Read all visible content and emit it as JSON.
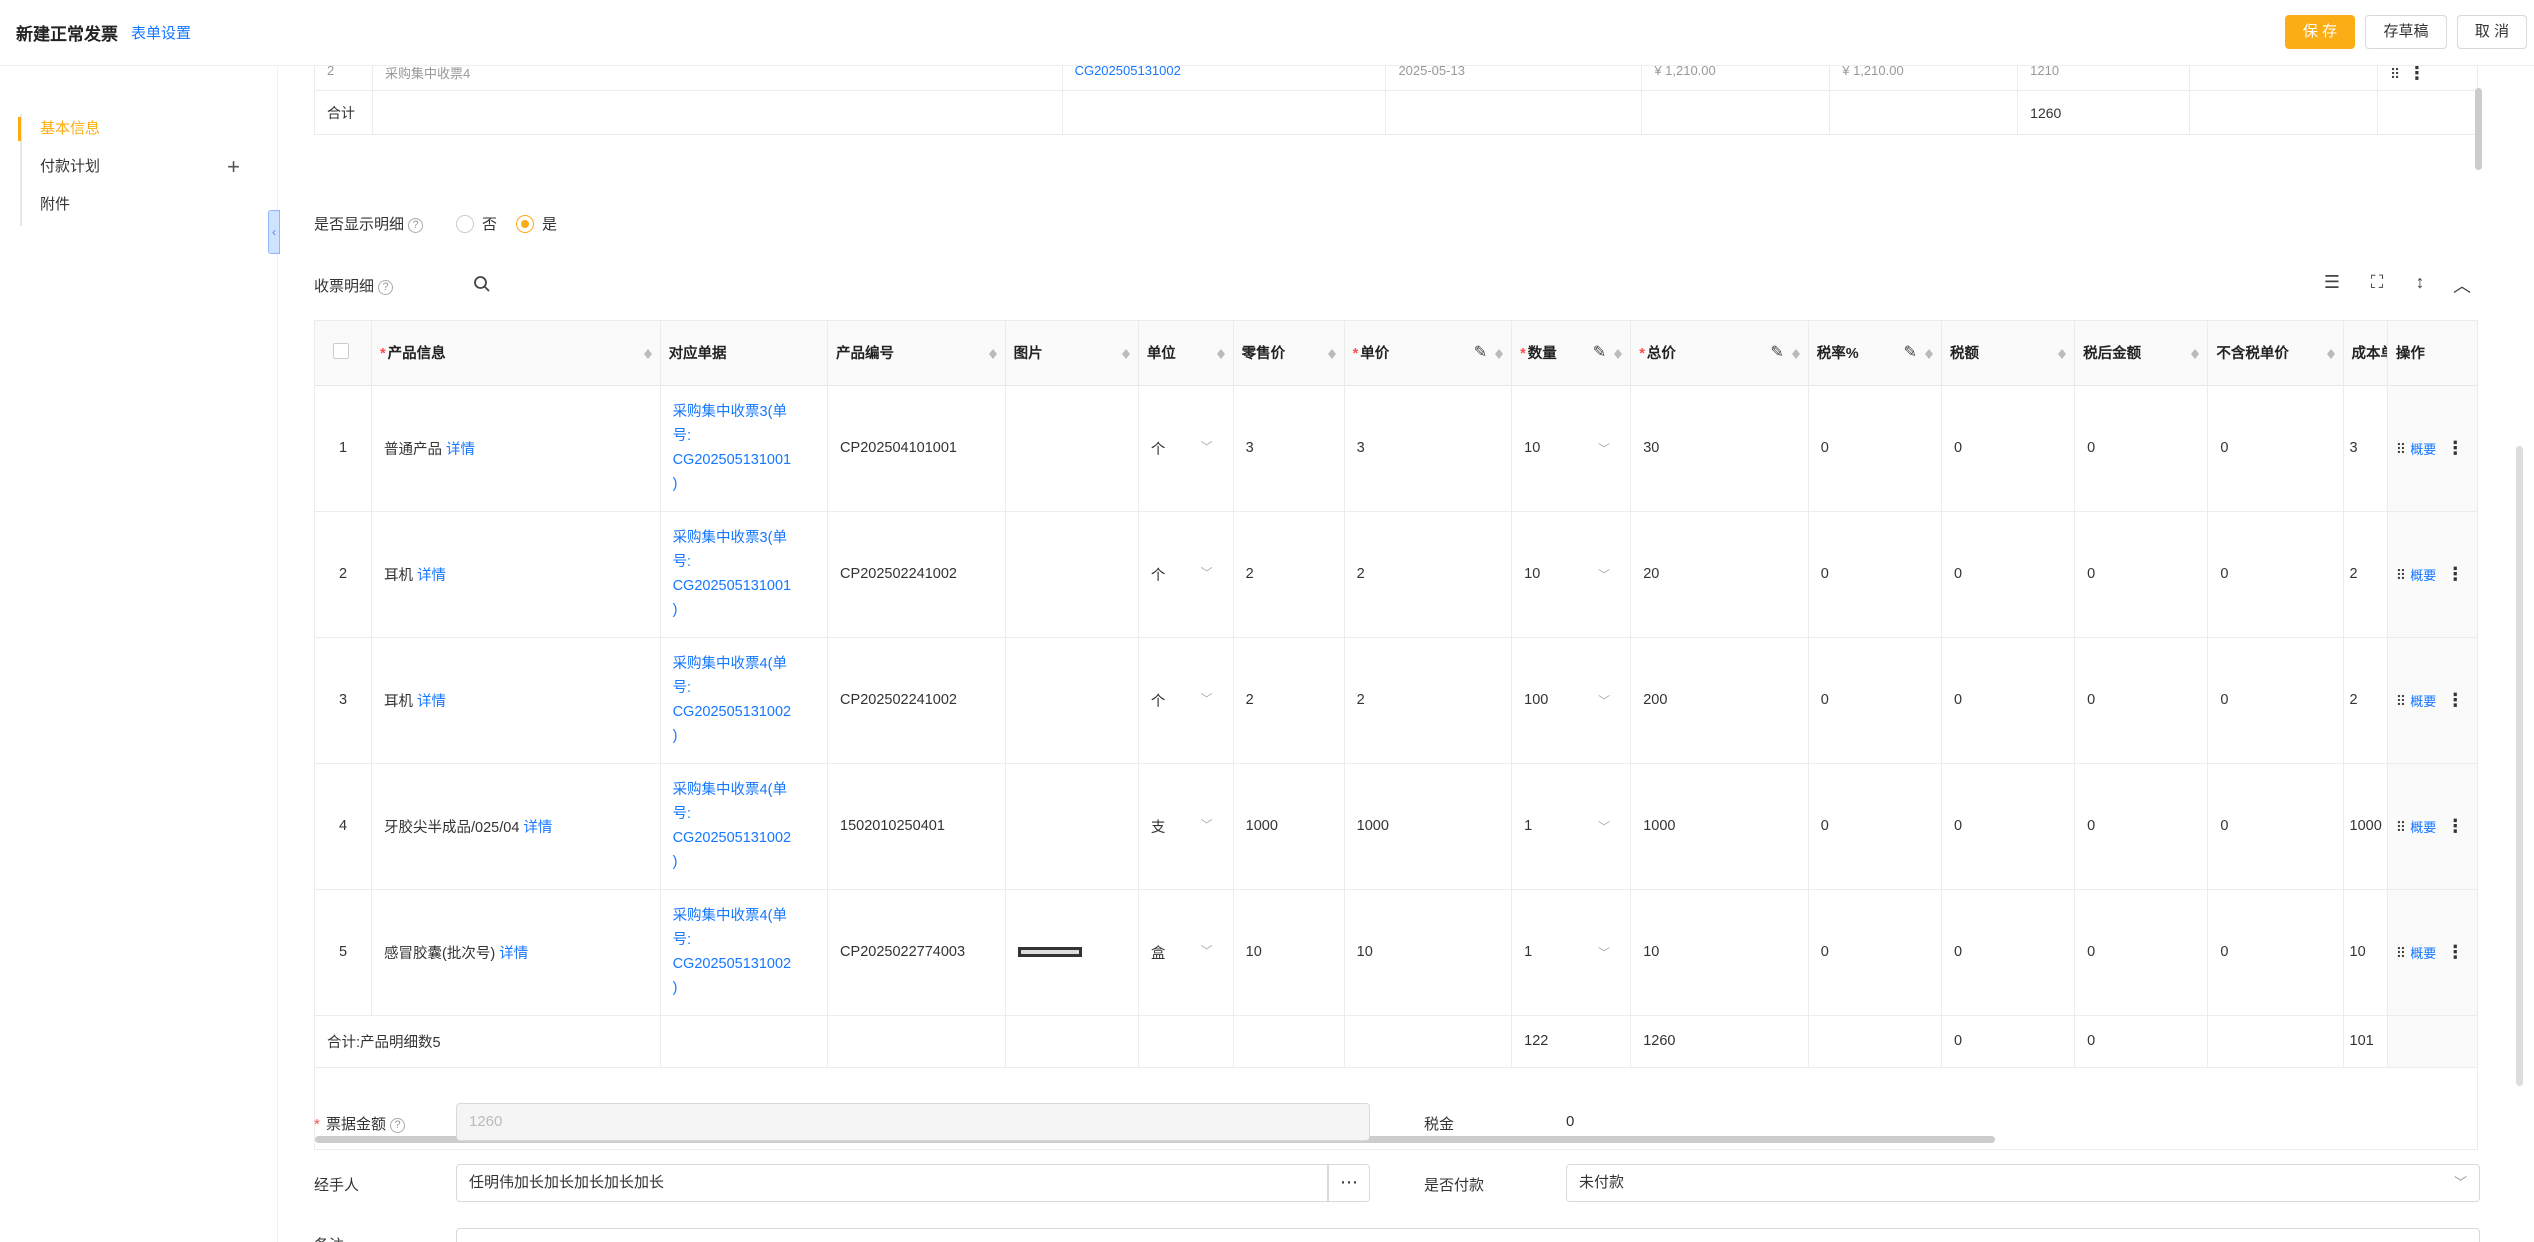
{
  "header": {
    "title": "新建正常发票",
    "form_settings": "表单设置",
    "save": "保 存",
    "draft": "存草稿",
    "cancel": "取 消"
  },
  "sidebar": {
    "items": [
      {
        "label": "基本信息",
        "active": true
      },
      {
        "label": "付款计划",
        "has_add": true
      },
      {
        "label": "附件"
      }
    ],
    "add_icon": "plus-icon",
    "collapse_icon": "chevron-left-icon"
  },
  "top_table": {
    "partial_row": {
      "index": "2",
      "name": "采购集中收票4",
      "order": "CG202505131002",
      "date": "2025-05-13",
      "amount1": "¥ 1,210.00",
      "amount2": "¥ 1,210.00",
      "qty": "1210"
    },
    "total_row": {
      "label": "合计",
      "value": "1260"
    }
  },
  "show_detail": {
    "label": "是否显示明细",
    "options": [
      "否",
      "是"
    ],
    "selected": "是"
  },
  "detail": {
    "label": "收票明细",
    "columns": [
      "产品信息",
      "对应单据",
      "产品编号",
      "图片",
      "单位",
      "零售价",
      "单价",
      "数量",
      "总价",
      "税率%",
      "税额",
      "税后金额",
      "不含税单价",
      "成本单",
      "操作"
    ],
    "rows": [
      {
        "no": "1",
        "product": "普通产品",
        "detail_link": "详情",
        "order_line1": "采购集中收票3(单",
        "order_line2": "号:",
        "order_line3": "CG202505131001",
        "order_line4": ")",
        "code": "CP202504101001",
        "has_image": false,
        "unit": "个",
        "retail": "3",
        "price": "3",
        "qty": "10",
        "total": "30",
        "tax_rate": "0",
        "tax": "0",
        "after_tax": "0",
        "ex_tax_price": "0",
        "cost": "3",
        "summary": "概要"
      },
      {
        "no": "2",
        "product": "耳机",
        "detail_link": "详情",
        "order_line1": "采购集中收票3(单",
        "order_line2": "号:",
        "order_line3": "CG202505131001",
        "order_line4": ")",
        "code": "CP202502241002",
        "has_image": false,
        "unit": "个",
        "retail": "2",
        "price": "2",
        "qty": "10",
        "total": "20",
        "tax_rate": "0",
        "tax": "0",
        "after_tax": "0",
        "ex_tax_price": "0",
        "cost": "2",
        "summary": "概要"
      },
      {
        "no": "3",
        "product": "耳机",
        "detail_link": "详情",
        "order_line1": "采购集中收票4(单",
        "order_line2": "号:",
        "order_line3": "CG202505131002",
        "order_line4": ")",
        "code": "CP202502241002",
        "has_image": false,
        "unit": "个",
        "retail": "2",
        "price": "2",
        "qty": "100",
        "total": "200",
        "tax_rate": "0",
        "tax": "0",
        "after_tax": "0",
        "ex_tax_price": "0",
        "cost": "2",
        "summary": "概要"
      },
      {
        "no": "4",
        "product": "牙胶尖半成品/025/04",
        "detail_link": "详情",
        "order_line1": "采购集中收票4(单",
        "order_line2": "号:",
        "order_line3": "CG202505131002",
        "order_line4": ")",
        "code": "1502010250401",
        "has_image": false,
        "unit": "支",
        "retail": "1000",
        "price": "1000",
        "qty": "1",
        "total": "1000",
        "tax_rate": "0",
        "tax": "0",
        "after_tax": "0",
        "ex_tax_price": "0",
        "cost": "1000",
        "summary": "概要"
      },
      {
        "no": "5",
        "product": "感冒胶囊(批次号)",
        "detail_link": "详情",
        "order_line1": "采购集中收票4(单",
        "order_line2": "号:",
        "order_line3": "CG202505131002",
        "order_line4": ")",
        "code": "CP2025022774003",
        "has_image": true,
        "unit": "盒",
        "retail": "10",
        "price": "10",
        "qty": "1",
        "total": "10",
        "tax_rate": "0",
        "tax": "0",
        "after_tax": "0",
        "ex_tax_price": "0",
        "cost": "10",
        "summary": "概要"
      }
    ],
    "summary_row": {
      "label": "合计:产品明细数5",
      "qty": "122",
      "total": "1260",
      "tax": "0",
      "after_tax": "0",
      "cost": "101"
    }
  },
  "form": {
    "amount_label": "票据金额",
    "amount_value": "1260",
    "tax_label": "税金",
    "tax_value": "0",
    "handler_label": "经手人",
    "handler_value": "任明伟加长加长加长加长加长",
    "paid_label": "是否付款",
    "paid_value": "未付款",
    "remark_label": "备注"
  },
  "colors": {
    "accent": "#faad14",
    "link": "#1677ff",
    "required": "#ff4d4f"
  }
}
